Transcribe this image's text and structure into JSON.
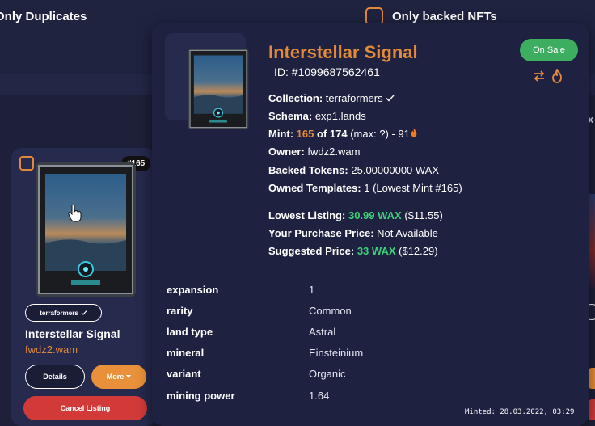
{
  "filters": {
    "duplicates_label": "Only Duplicates",
    "backed_label": "Only backed NFTs"
  },
  "card": {
    "mint_badge": "#165",
    "collection": "terraformers",
    "name": "Interstellar Signal",
    "owner": "fwdz2.wam",
    "details_label": "Details",
    "more_label": "More",
    "cancel_label": "Cancel Listing"
  },
  "popup": {
    "title": "Interstellar Signal",
    "id": "ID: #1099687562461",
    "status": "On Sale",
    "collection_label": "Collection:",
    "collection_value": "terraformers",
    "schema_label": "Schema:",
    "schema_value": "exp1.lands",
    "mint_label": "Mint:",
    "mint_number": "165",
    "mint_of": "of 174",
    "mint_max": "(max: ?) - 91",
    "owner_label": "Owner:",
    "owner_value": "fwdz2.wam",
    "backed_label": "Backed Tokens:",
    "backed_value": "25.00000000 WAX",
    "owned_label": "Owned Templates:",
    "owned_value": "1 (Lowest Mint #165)",
    "lowest_label": "Lowest Listing:",
    "lowest_wax": "30.99 WAX",
    "lowest_usd": "($11.55)",
    "purchase_label": "Your Purchase Price:",
    "purchase_value": "Not Available",
    "suggested_label": "Suggested Price:",
    "suggested_wax": "33 WAX",
    "suggested_usd": "($12.29)",
    "attributes": [
      {
        "key": "expansion",
        "value": "1"
      },
      {
        "key": "rarity",
        "value": "Common"
      },
      {
        "key": "land type",
        "value": "Astral"
      },
      {
        "key": "mineral",
        "value": "Einsteinium"
      },
      {
        "key": "variant",
        "value": "Organic"
      },
      {
        "key": "mining power",
        "value": "1.64"
      }
    ],
    "minted": "Minted: 28.03.2022, 03:29"
  },
  "colors": {
    "accent": "#e38a3a",
    "positive": "#3dd17a",
    "on_sale": "#3dae5f",
    "danger": "#d23a3a"
  }
}
